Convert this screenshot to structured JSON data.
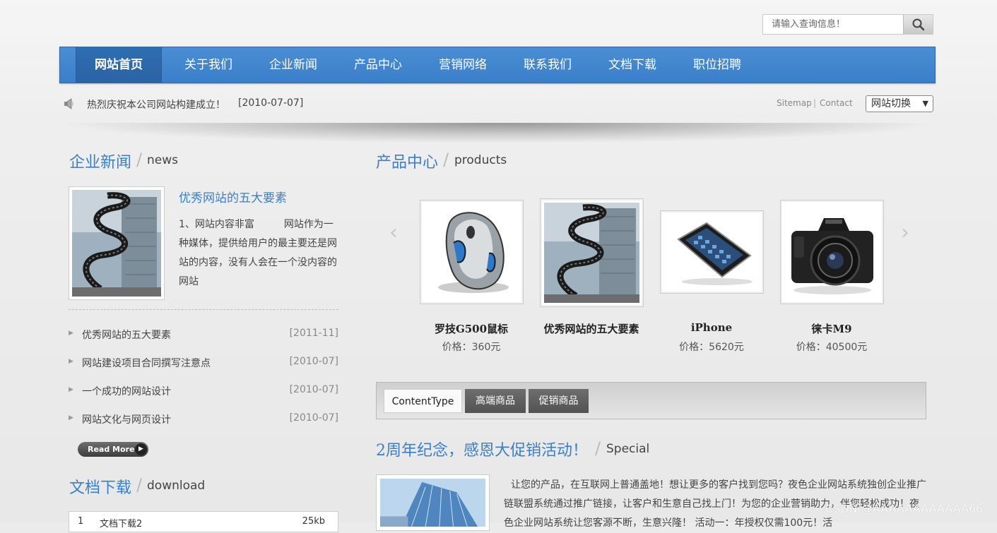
{
  "search": {
    "placeholder": "请输入查询信息！"
  },
  "nav": {
    "items": [
      {
        "label": "网站首页"
      },
      {
        "label": "关于我们"
      },
      {
        "label": "企业新闻"
      },
      {
        "label": "产品中心"
      },
      {
        "label": "营销网络"
      },
      {
        "label": "联系我们"
      },
      {
        "label": "文档下载"
      },
      {
        "label": "职位招聘"
      }
    ],
    "active_index": 0
  },
  "notice": {
    "text": "热烈庆祝本公司网站构建成立！",
    "date": "[2010-07-07]"
  },
  "top_links": {
    "sitemap": "Sitemap",
    "separator": "|",
    "contact": "Contact",
    "site_switch": "网站切换"
  },
  "news": {
    "title": "企业新闻",
    "slash": "/",
    "subtitle": "news",
    "feature": {
      "title": "优秀网站的五大要素",
      "text": "1、网站内容非富　　　网站作为一种媒体，提供给用户的最主要还是网站的内容，没有人会在一个没内容的网站"
    },
    "items": [
      {
        "title": "优秀网站的五大要素",
        "date": "[2011-11]"
      },
      {
        "title": "网站建设项目合同撰写注意点",
        "date": "[2010-07]"
      },
      {
        "title": "一个成功的网站设计",
        "date": "[2010-07]"
      },
      {
        "title": "网站文化与网页设计",
        "date": "[2010-07]"
      }
    ],
    "read_more": "Read More"
  },
  "download": {
    "title": "文档下载",
    "slash": "/",
    "subtitle": "download",
    "first_row": {
      "num": "1",
      "name": "文档下载2",
      "size": "25kb"
    }
  },
  "products": {
    "title": "产品中心",
    "slash": "/",
    "subtitle": "products",
    "items": [
      {
        "name": "罗技G500鼠标",
        "price": "价格：360元"
      },
      {
        "name": "优秀网站的五大要素",
        "price": ""
      },
      {
        "name": "iPhone",
        "price": "价格：5620元"
      },
      {
        "name": "徕卡M9",
        "price": "价格：40500元"
      }
    ]
  },
  "tabs": [
    {
      "label": "ContentType"
    },
    {
      "label": "高端商品"
    },
    {
      "label": "促销商品"
    }
  ],
  "special": {
    "title": "2周年纪念，感恩大促销活动！",
    "slash": "/",
    "subtitle": "Special",
    "text": "让您的产品，在互联网上普通盖地！想让更多的客户找到您吗？夜色企业网站系统独创企业推广链联盟系统通过推广链接，让客户和生意自己找上门！为您的企业营销助力，伴您轻松成功！夜色企业网站系统让您客源不断，生意兴隆！ 活动一：年授权仅需100元！活"
  },
  "watermark": "CSDN @AAAAAAAAAAAA66",
  "colors": {
    "accent": "#3a7fc9",
    "nav_bg": "#3d82cc"
  },
  "icons": {
    "search": "magnifier-icon",
    "notice": "speaker-icon",
    "prev": "chevron-left-icon",
    "next": "chevron-right-icon"
  }
}
